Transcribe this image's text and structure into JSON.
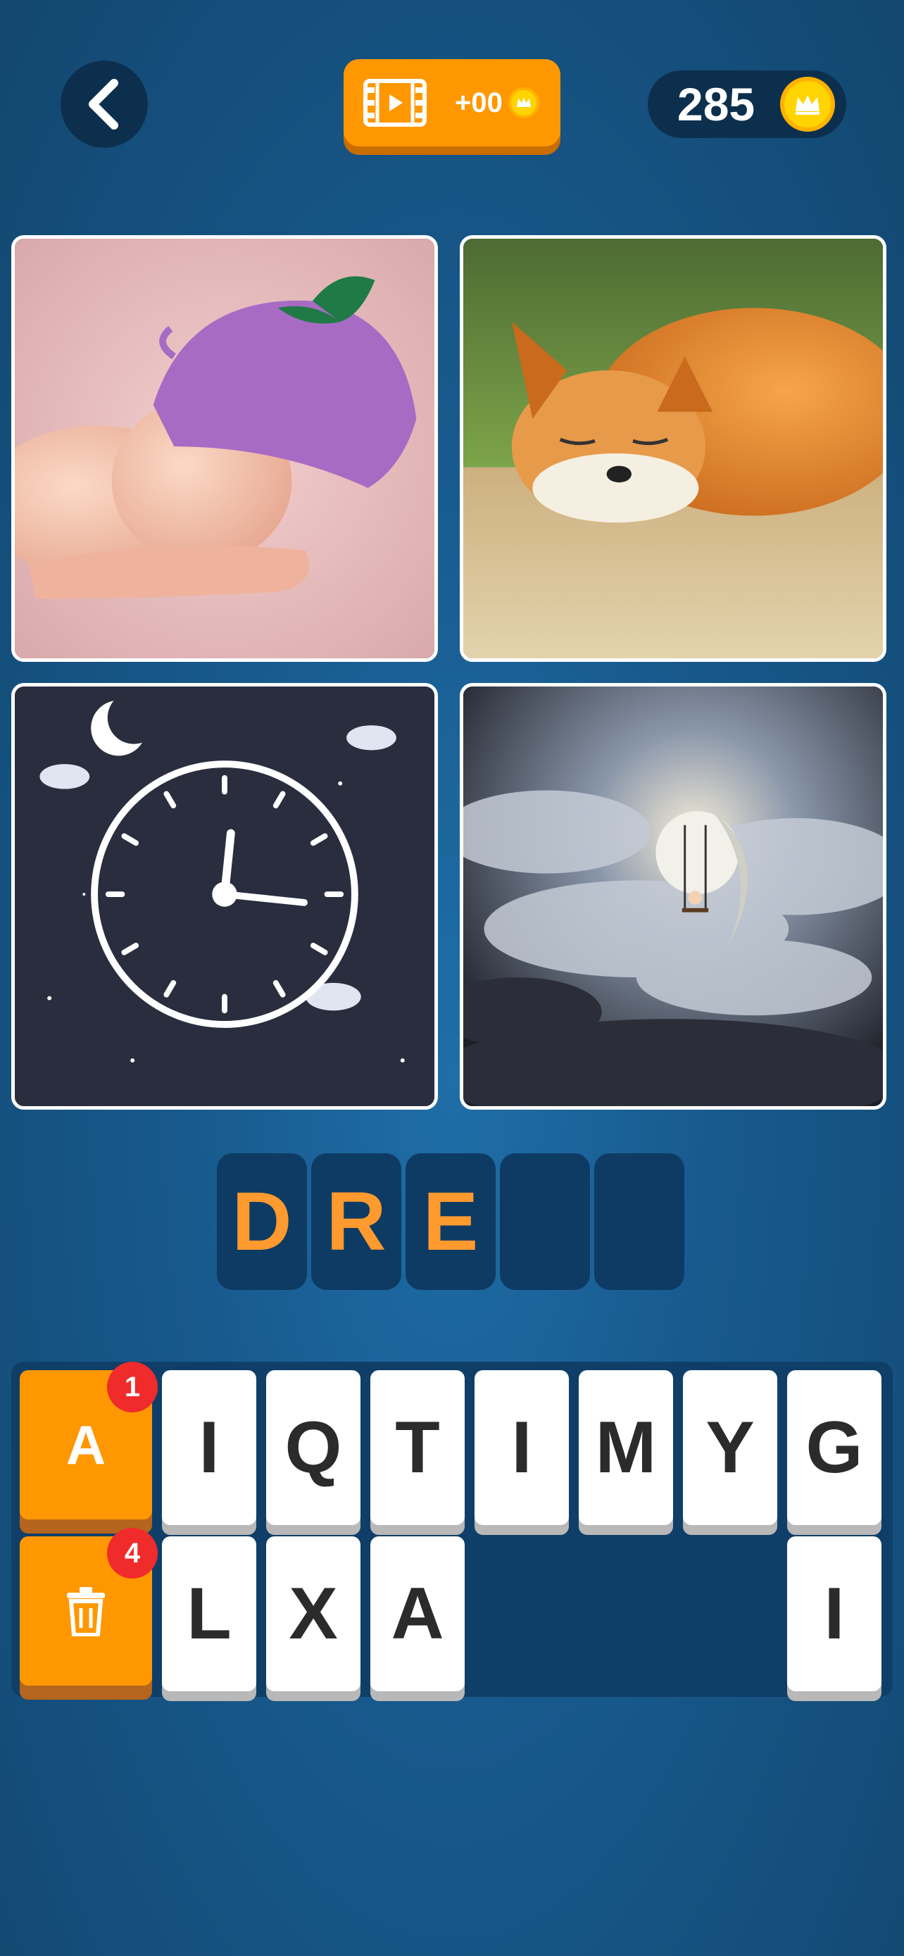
{
  "header": {
    "video_reward": "+00",
    "coin_count": "285",
    "icons": [
      "back-arrow-icon",
      "film-icon",
      "crown-coin-icon"
    ]
  },
  "answer": {
    "slots": [
      "D",
      "R",
      "E",
      "",
      ""
    ]
  },
  "keyboard": {
    "hint_letter": "A",
    "hint_badge": "1",
    "remove_badge": "4",
    "row1": [
      "I",
      "Q",
      "T",
      "I",
      "M",
      "Y",
      "G"
    ],
    "row2": [
      "L",
      "X",
      "A",
      "",
      "",
      "",
      "I"
    ]
  },
  "colors": {
    "accent_orange": "#ff9800",
    "slot_letter": "#ff9a2e",
    "badge_red": "#f02b2b",
    "coin_gold": "#ffd400"
  }
}
